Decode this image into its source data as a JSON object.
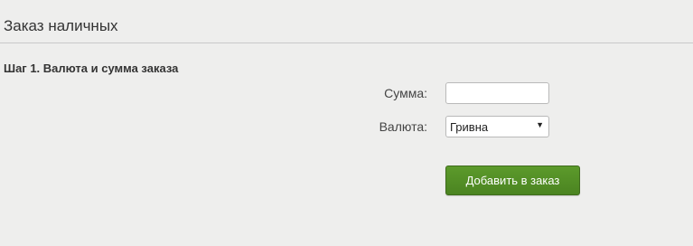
{
  "page": {
    "title": "Заказ наличных"
  },
  "form": {
    "step_title": "Шаг 1. Валюта и сумма заказа",
    "amount_label": "Сумма:",
    "amount_value": "",
    "currency_label": "Валюта:",
    "currency_selected": "Гривна",
    "submit_label": "Добавить в заказ"
  },
  "icons": {
    "select_arrow": "chevron-down-icon"
  },
  "colors": {
    "background": "#eeeeed",
    "button_green": "#4f8a24",
    "divider": "#c9c9c9"
  }
}
